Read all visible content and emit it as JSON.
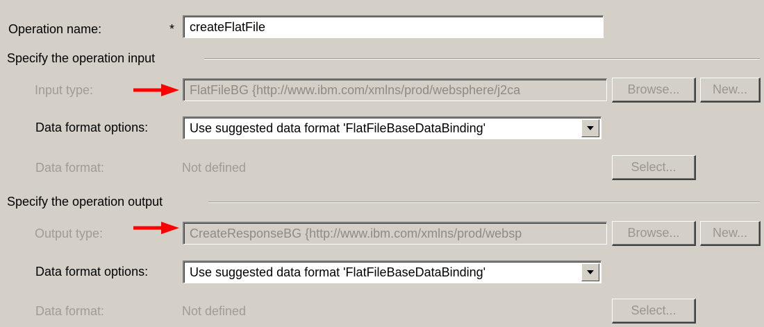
{
  "operation": {
    "name_label": "Operation name:",
    "required_marker": "*",
    "name_value": "createFlatFile"
  },
  "input_section": {
    "title": "Specify the operation input",
    "type_label": "Input type:",
    "type_value": "FlatFileBG  {http://www.ibm.com/xmlns/prod/websphere/j2ca",
    "browse_label": "Browse...",
    "new_label": "New...",
    "format_options_label": "Data format options:",
    "format_options_value": "Use suggested data format 'FlatFileBaseDataBinding'",
    "format_label": "Data format:",
    "format_value": "Not defined",
    "select_label": "Select..."
  },
  "output_section": {
    "title": "Specify the operation output",
    "type_label": "Output type:",
    "type_value": "CreateResponseBG  {http://www.ibm.com/xmlns/prod/websp",
    "browse_label": "Browse...",
    "new_label": "New...",
    "format_options_label": "Data format options:",
    "format_options_value": "Use suggested data format 'FlatFileBaseDataBinding'",
    "format_label": "Data format:",
    "format_value": "Not defined",
    "select_label": "Select..."
  },
  "icons": {
    "annotation_arrow": "red-right-arrow-icon",
    "dropdown_arrow": "chevron-down-icon"
  },
  "colors": {
    "background": "#d4d0c8",
    "annotation": "#ff0000",
    "disabled_text": "#a09c94"
  }
}
